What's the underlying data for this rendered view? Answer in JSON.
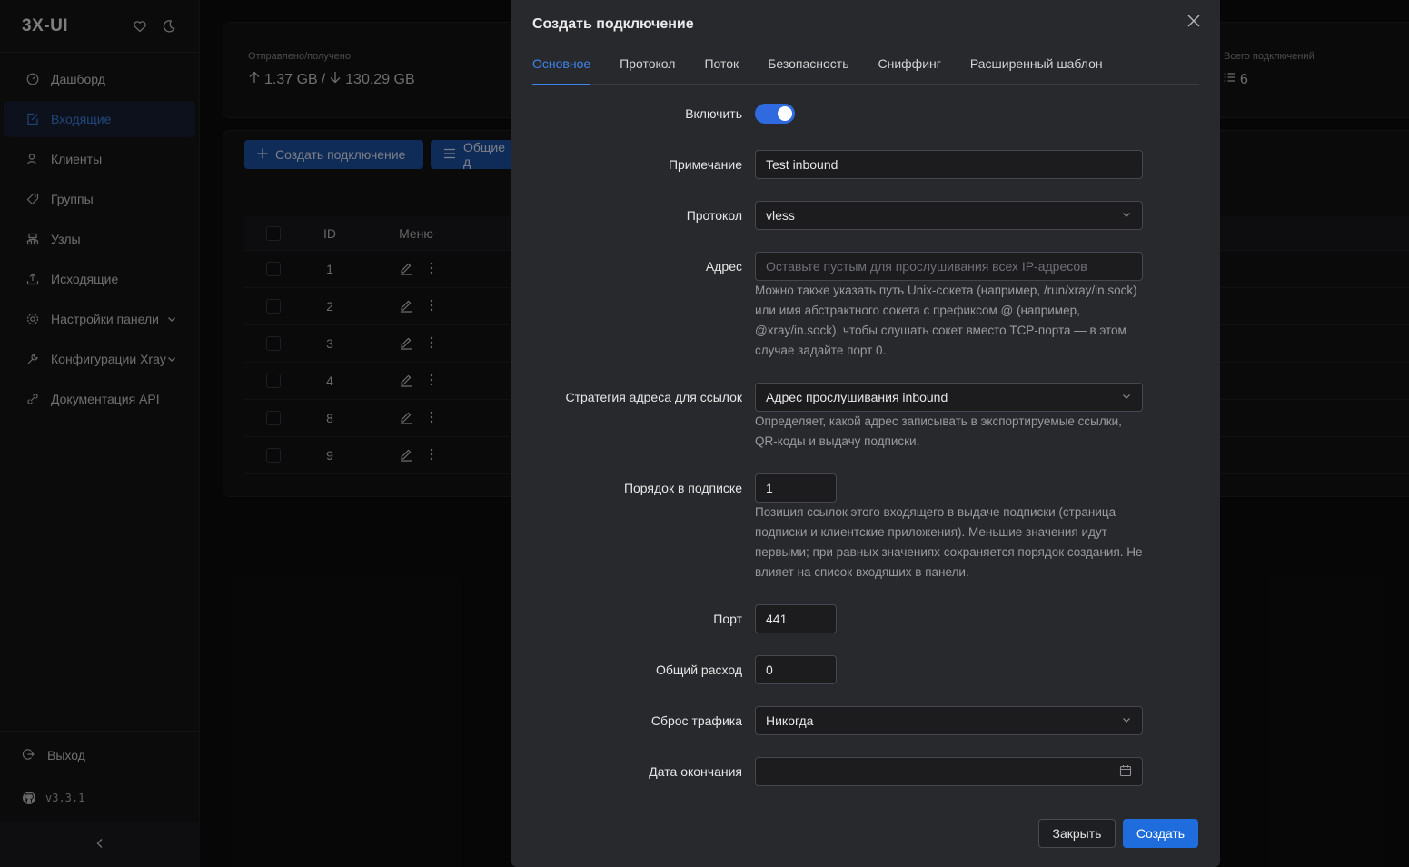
{
  "app": {
    "brand": "3X-UI",
    "version": "v3.3.1"
  },
  "sidebar": {
    "items": [
      {
        "label": "Дашборд",
        "icon": "dashboard-icon"
      },
      {
        "label": "Входящие",
        "icon": "inbound-icon",
        "active": true
      },
      {
        "label": "Клиенты",
        "icon": "clients-icon"
      },
      {
        "label": "Группы",
        "icon": "tag-icon"
      },
      {
        "label": "Узлы",
        "icon": "nodes-icon"
      },
      {
        "label": "Исходящие",
        "icon": "upload-icon"
      },
      {
        "label": "Настройки панели",
        "icon": "settings-icon",
        "expandable": true
      },
      {
        "label": "Конфигурации Xray",
        "icon": "tool-icon",
        "expandable": true
      },
      {
        "label": "Документация API",
        "icon": "api-icon"
      }
    ],
    "logout": "Выход"
  },
  "background": {
    "stats": {
      "traffic_label": "Отправлено/получено",
      "sent": "1.37 GB",
      "separator": "/",
      "received": "130.29 GB",
      "connections_label": "Всего подключений",
      "connections": "6"
    },
    "toolbar": {
      "create_button": "Создать подключение",
      "general_button": "Общие д"
    },
    "table": {
      "headers": {
        "id": "ID",
        "menu": "Меню"
      },
      "rows": [
        "1",
        "2",
        "3",
        "4",
        "8",
        "9"
      ]
    }
  },
  "modal": {
    "title": "Создать подключение",
    "tabs": [
      "Основное",
      "Протокол",
      "Поток",
      "Безопасность",
      "Сниффинг",
      "Расширенный шаблон"
    ],
    "active_tab": "Основное",
    "fields": {
      "enable": {
        "label": "Включить",
        "value": true
      },
      "remark": {
        "label": "Примечание",
        "value": "Test inbound"
      },
      "protocol": {
        "label": "Протокол",
        "value": "vless"
      },
      "address": {
        "label": "Адрес",
        "placeholder": "Оставьте пустым для прослушивания всех IP-адресов",
        "help": "Можно также указать путь Unix-сокета (например, /run/xray/in.sock) или имя абстрактного сокета с префиксом @ (например, @xray/in.sock), чтобы слушать сокет вместо TCP-порта — в этом случае задайте порт 0."
      },
      "link_strategy": {
        "label": "Стратегия адреса для ссылок",
        "value": "Адрес прослушивания inbound",
        "help": "Определяет, какой адрес записывать в экспортируемые ссылки, QR-коды и выдачу подписки."
      },
      "sub_order": {
        "label": "Порядок в подписке",
        "value": "1",
        "help": "Позиция ссылок этого входящего в выдаче подписки (страница подписки и клиентские приложения). Меньшие значения идут первыми; при равных значениях сохраняется порядок создания. Не влияет на список входящих в панели."
      },
      "port": {
        "label": "Порт",
        "value": "441"
      },
      "total": {
        "label": "Общий расход",
        "value": "0"
      },
      "reset": {
        "label": "Сброс трафика",
        "value": "Никогда"
      },
      "expiry": {
        "label": "Дата окончания",
        "value": ""
      }
    },
    "buttons": {
      "close": "Закрыть",
      "create": "Создать"
    }
  },
  "colors": {
    "accent": "#3d86f0",
    "primary_button": "#1f6ddc",
    "modal_bg": "#28292d",
    "sidebar_bg": "#151517"
  }
}
